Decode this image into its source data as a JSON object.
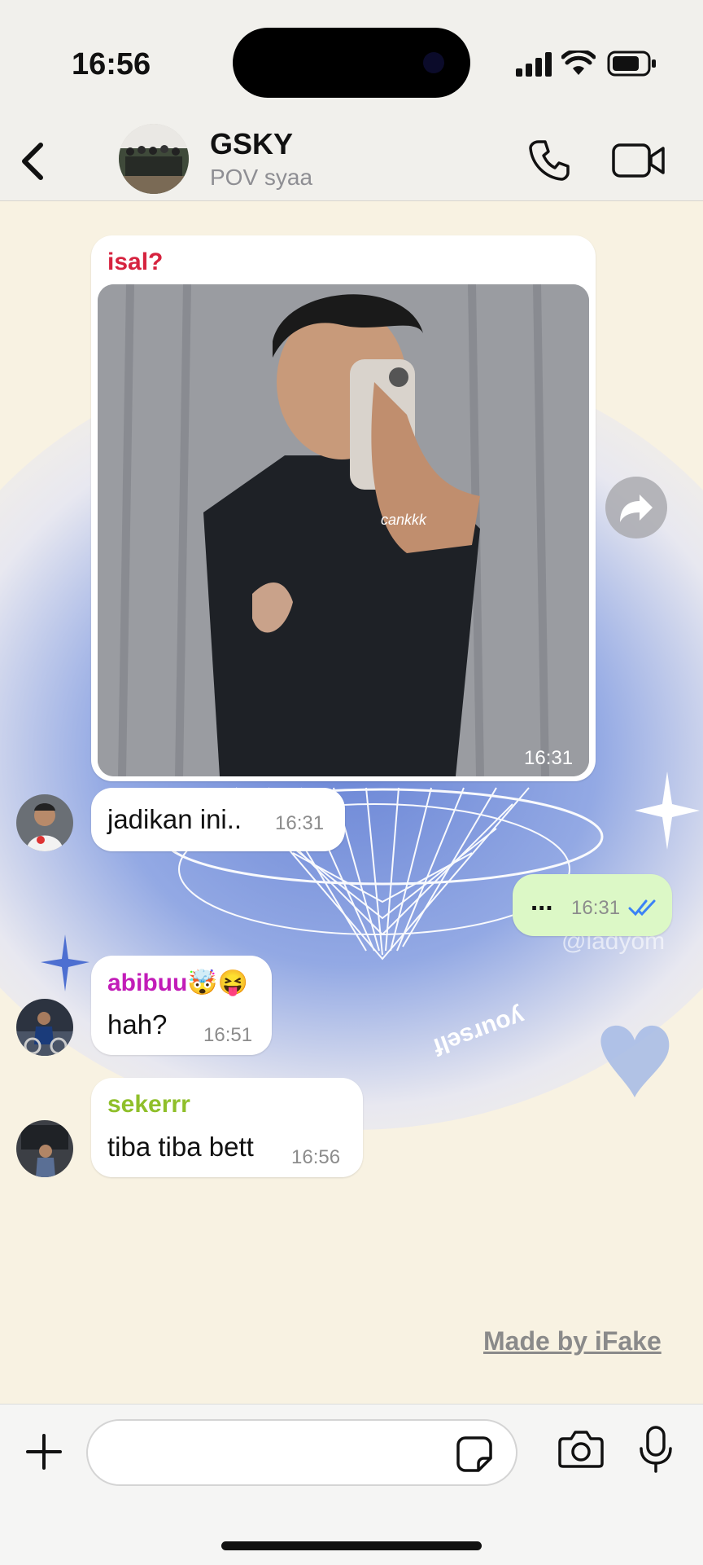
{
  "status_bar": {
    "time": "16:56"
  },
  "header": {
    "group_name": "GSKY",
    "subtitle": "POV syaa"
  },
  "messages": [
    {
      "sender": "isal?",
      "sender_color": "#d6233f",
      "type": "image",
      "time": "16:31",
      "photo_caption": "cankkk"
    },
    {
      "text": "jadikan ini..",
      "time": "16:31"
    },
    {
      "text": "...",
      "time": "16:31",
      "outgoing": true,
      "read": true
    },
    {
      "sender": "abibuu🤯😝",
      "sender_color": "#c21cb8",
      "text": "hah?",
      "time": "16:51"
    },
    {
      "sender": "sekerrr",
      "sender_color": "#8fbf2a",
      "text": "tiba tiba bett",
      "time": "16:56"
    }
  ],
  "wallpaper": {
    "text": "yourself",
    "tiktok_handle": "@ladyom"
  },
  "watermark": "Made by iFake",
  "input": {
    "placeholder": ""
  },
  "colors": {
    "accent_blue": "#3b82f6",
    "outgoing_bubble": "#dcf8c6"
  },
  "icons": [
    "back-chevron-icon",
    "phone-icon",
    "video-camera-icon",
    "forward-icon",
    "plus-icon",
    "sticker-icon",
    "camera-icon",
    "microphone-icon",
    "double-check-icon"
  ]
}
